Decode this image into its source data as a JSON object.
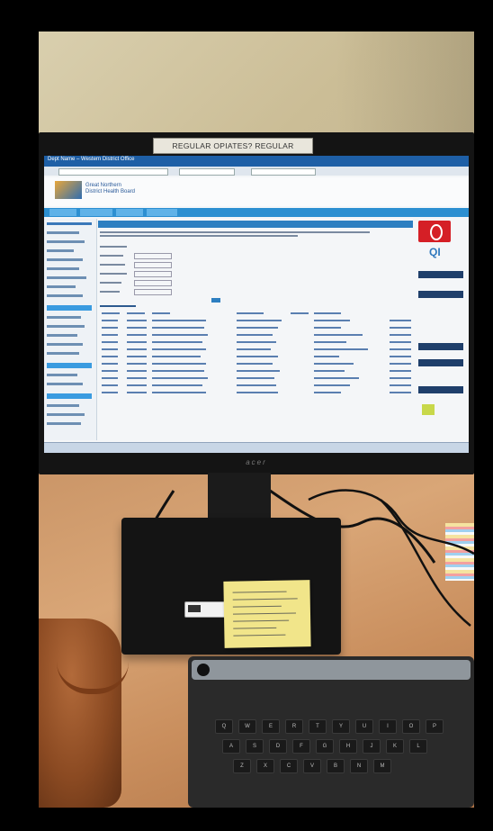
{
  "photo": {
    "tape_label": "REGULAR OPIATES? REGULAR LAXATIVE ✓",
    "monitor_brand": "acer"
  },
  "screen": {
    "window_title": "Dept Name – Western District Office",
    "logo_text_line1": "Great Northern",
    "logo_text_line2": "District Health Board"
  },
  "colors": {
    "nav_blue": "#2c8fd1",
    "title_blue": "#1e5fa6",
    "alert_red": "#d51f26",
    "sticky_note": "#f1e58a"
  },
  "keyboard": {
    "row1": [
      "Q",
      "W",
      "E",
      "R",
      "T",
      "Y",
      "U",
      "I",
      "O",
      "P"
    ],
    "row2": [
      "A",
      "S",
      "D",
      "F",
      "G",
      "H",
      "J",
      "K",
      "L"
    ],
    "row3": [
      "Z",
      "X",
      "C",
      "V",
      "B",
      "N",
      "M"
    ]
  }
}
